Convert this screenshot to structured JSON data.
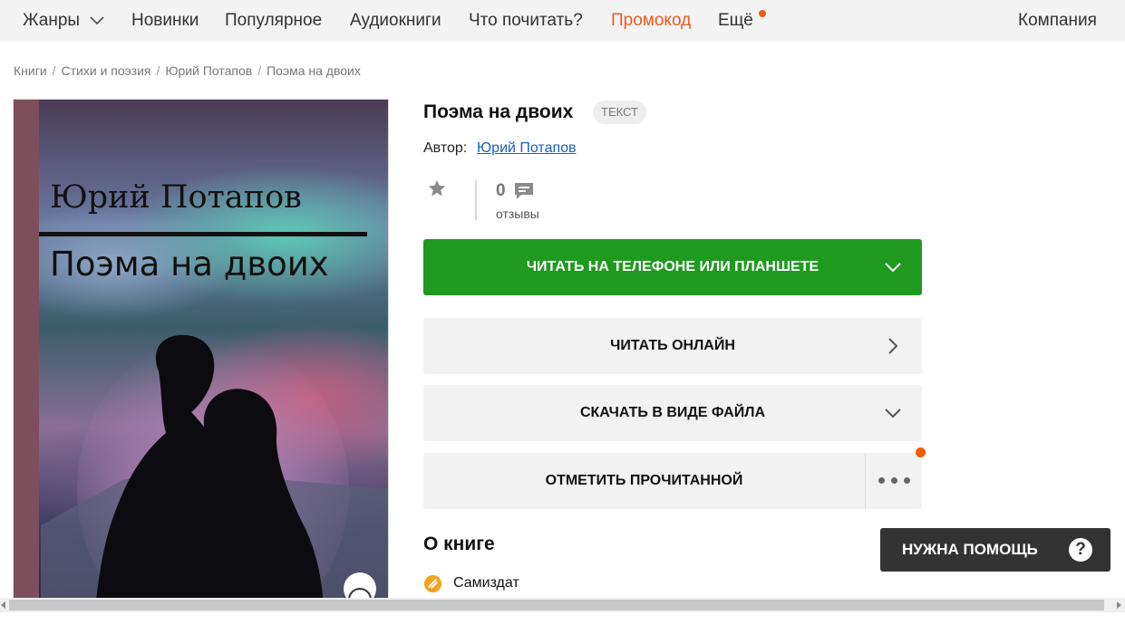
{
  "nav": {
    "items": [
      {
        "label": "Жанры"
      },
      {
        "label": "Новинки"
      },
      {
        "label": "Популярное"
      },
      {
        "label": "Аудиокниги"
      },
      {
        "label": "Что почитать?"
      },
      {
        "label": "Промокод"
      },
      {
        "label": "Ещё"
      }
    ],
    "company": "Компания",
    "promo_color": "#ec5a21",
    "notification_dot_color": "#f25c05"
  },
  "breadcrumb": [
    "Книги",
    "Стихи и поэзия",
    "Юрий Потапов",
    "Поэма на двоих"
  ],
  "cover": {
    "author": "Юрий Потапов",
    "title": "Поэма на двоих"
  },
  "book": {
    "title": "Поэма на двоих",
    "tag": "ТЕКСТ",
    "author_label": "Автор:",
    "author_name": "Юрий Потапов",
    "reviews_count": "0",
    "reviews_label": "отзывы"
  },
  "actions": {
    "read_on_device": "Читать на телефоне или планшете",
    "read_online": "Читать онлайн",
    "download": "Скачать в виде файла",
    "mark_read": "Отметить прочитанной",
    "primary_color": "#1f9a1f"
  },
  "about": {
    "heading": "О книге",
    "publisher": "Самиздат"
  },
  "help": {
    "label": "Нужна помощь",
    "icon": "?"
  }
}
